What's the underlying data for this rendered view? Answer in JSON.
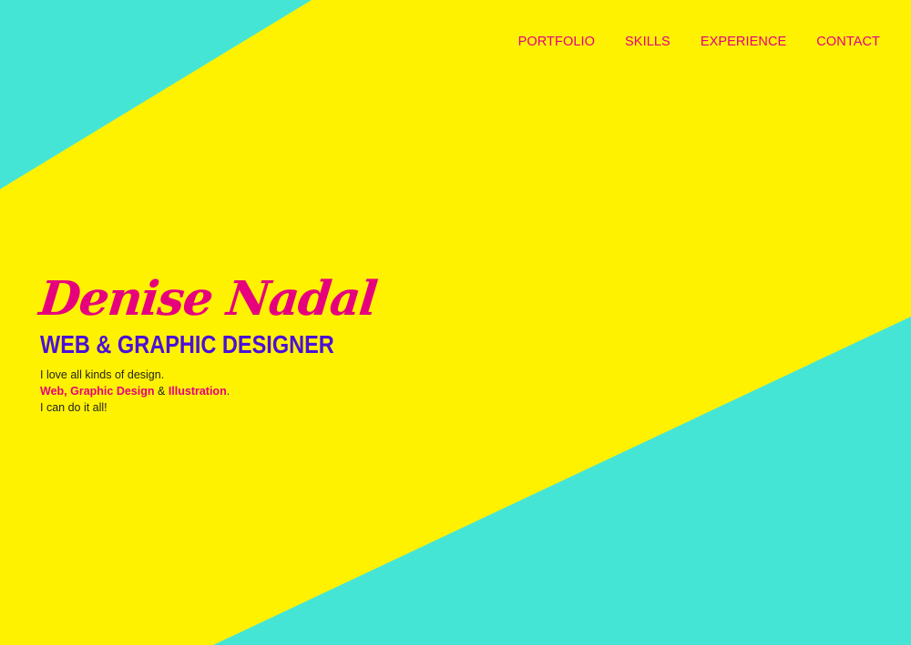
{
  "colors": {
    "yellow": "#FFF200",
    "turquoise": "#45E5D6",
    "pink": "#E6007E",
    "purple": "#4A10D8",
    "text": "#222222"
  },
  "nav": {
    "items": [
      {
        "label": "PORTFOLIO"
      },
      {
        "label": "SKILLS"
      },
      {
        "label": "EXPERIENCE"
      },
      {
        "label": "CONTACT"
      }
    ]
  },
  "hero": {
    "name": "Denise Nadal",
    "title": "WEB & GRAPHIC DESIGNER",
    "line1": "I love all kinds of design.",
    "line2": {
      "web": "Web",
      "comma": ", ",
      "graphic": "Graphic Design",
      "amp": " & ",
      "illustration": "Illustration",
      "period": "."
    },
    "line3": "I can do it all!"
  }
}
